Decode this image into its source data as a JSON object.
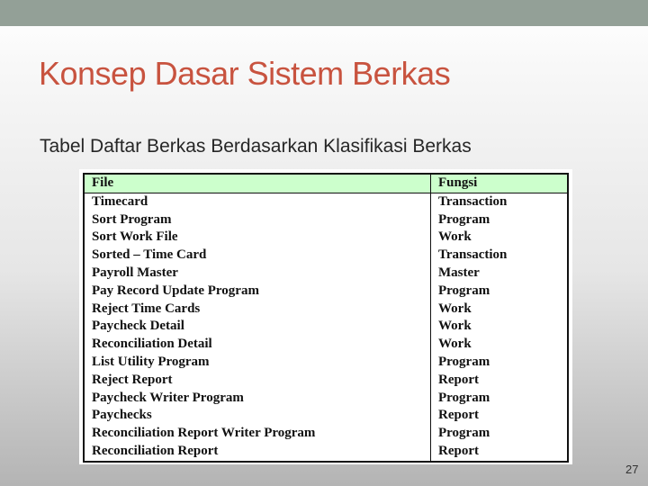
{
  "slide": {
    "title": "Konsep Dasar Sistem Berkas",
    "subtitle": "Tabel Daftar Berkas Berdasarkan Klasifikasi Berkas",
    "page_number": "27",
    "colors": {
      "top_bar": "#93a097",
      "title": "#c8533f",
      "table_header_bg": "#ccffcc"
    }
  },
  "table": {
    "headers": [
      "File",
      "Fungsi"
    ],
    "rows": [
      [
        "Timecard",
        "Transaction"
      ],
      [
        "Sort Program",
        "Program"
      ],
      [
        "Sort Work File",
        "Work"
      ],
      [
        "Sorted – Time Card",
        "Transaction"
      ],
      [
        "Payroll Master",
        "Master"
      ],
      [
        "Pay Record Update Program",
        "Program"
      ],
      [
        "Reject Time Cards",
        "Work"
      ],
      [
        "Paycheck Detail",
        "Work"
      ],
      [
        "Reconciliation Detail",
        "Work"
      ],
      [
        "List Utility Program",
        "Program"
      ],
      [
        "Reject Report",
        "Report"
      ],
      [
        "Paycheck Writer Program",
        "Program"
      ],
      [
        "Paychecks",
        "Report"
      ],
      [
        "Reconciliation Report Writer Program",
        "Program"
      ],
      [
        "Reconciliation Report",
        "Report"
      ]
    ]
  }
}
